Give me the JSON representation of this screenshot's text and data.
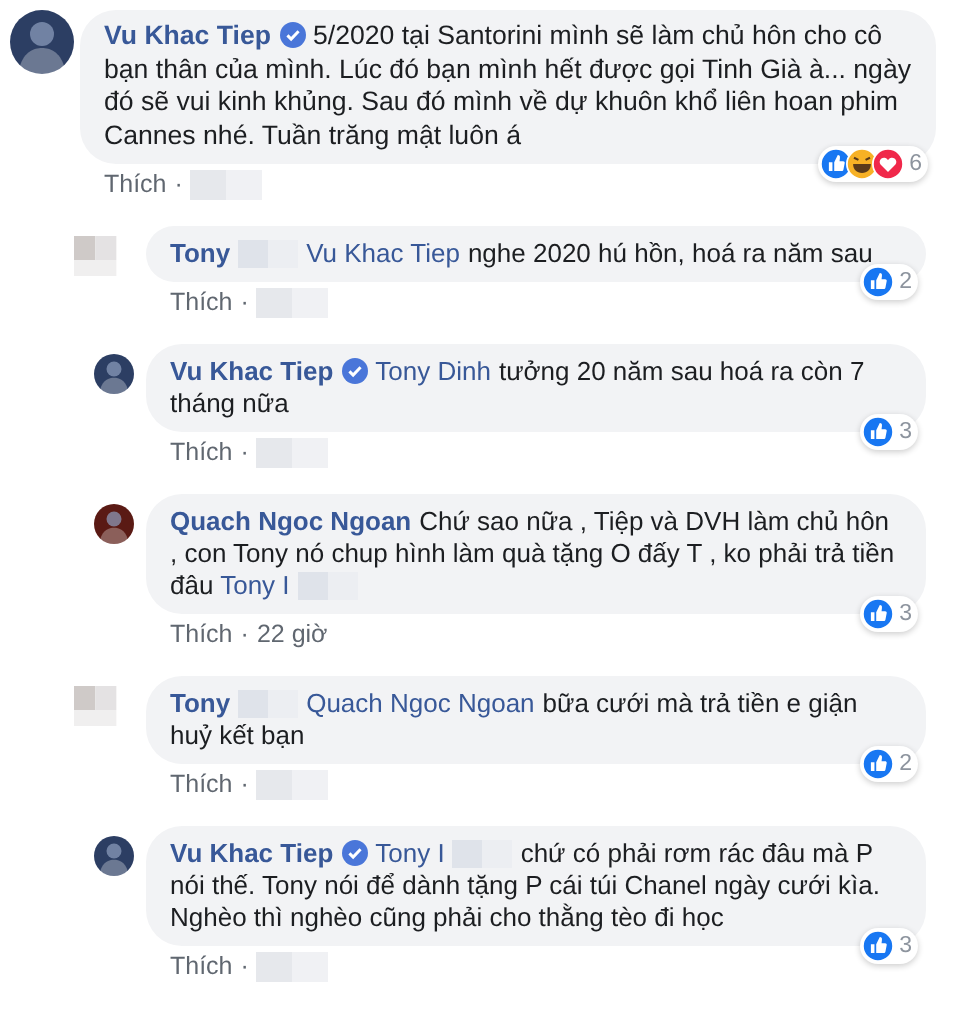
{
  "comments": [
    {
      "avatar": {
        "kind": "photo",
        "color": "#2c3e63"
      },
      "parts": [
        {
          "kind": "author",
          "text": "Vu Khac Tiep"
        },
        {
          "kind": "verified"
        },
        {
          "kind": "text",
          "text": "5/2020 tại Santorini mình sẽ làm chủ hôn cho cô bạn thân của mình. Lúc đó bạn mình hết được gọi Tinh Già à... ngày đó sẽ vui kinh khủng. Sau đó mình về dự khuôn khổ liên hoan phim Cannes nhé. Tuần trăng mật luôn á"
        }
      ],
      "reactions": [
        {
          "kind": "like"
        },
        {
          "kind": "haha"
        },
        {
          "kind": "love"
        }
      ],
      "count": "6",
      "like_label": "Thích",
      "separator": "·",
      "children": [
        {
          "avatar": {
            "kind": "redacted"
          },
          "parts": [
            {
              "kind": "author",
              "text": "Tony"
            },
            {
              "kind": "redacted"
            },
            {
              "kind": "mention",
              "text": "Vu Khac Tiep"
            },
            {
              "kind": "text",
              "text": "nghe 2020 hú hồn, hoá ra năm sau"
            }
          ],
          "reactions": [
            {
              "kind": "like"
            }
          ],
          "count": "2",
          "like_label": "Thích",
          "separator": "·"
        },
        {
          "avatar": {
            "kind": "photo",
            "color": "#2c3e63"
          },
          "parts": [
            {
              "kind": "author",
              "text": "Vu Khac Tiep"
            },
            {
              "kind": "verified"
            },
            {
              "kind": "mention",
              "text": "Tony Dinh"
            },
            {
              "kind": "text",
              "text": "tưởng 20 năm sau hoá ra còn 7 tháng nữa"
            }
          ],
          "reactions": [
            {
              "kind": "like"
            }
          ],
          "count": "3",
          "like_label": "Thích",
          "separator": "·"
        },
        {
          "avatar": {
            "kind": "photo",
            "color": "#5a1a14"
          },
          "parts": [
            {
              "kind": "author",
              "text": "Quach Ngoc Ngoan"
            },
            {
              "kind": "text",
              "text": "Chứ sao nữa , Tiệp và DVH làm chủ hôn , con Tony nó chup hình làm quà tặng O đấy T , ko phải trả tiền đâu"
            },
            {
              "kind": "mention",
              "text": "Tony I"
            },
            {
              "kind": "redacted"
            }
          ],
          "reactions": [
            {
              "kind": "like"
            }
          ],
          "count": "3",
          "like_label": "Thích",
          "separator": "·",
          "time": "22 giờ"
        },
        {
          "avatar": {
            "kind": "redacted"
          },
          "parts": [
            {
              "kind": "author",
              "text": "Tony"
            },
            {
              "kind": "redacted"
            },
            {
              "kind": "mention",
              "text": "Quach Ngoc Ngoan"
            },
            {
              "kind": "text",
              "text": "bữa cưới mà trả tiền e giận huỷ kết bạn"
            }
          ],
          "reactions": [
            {
              "kind": "like"
            }
          ],
          "count": "2",
          "like_label": "Thích",
          "separator": "·"
        },
        {
          "avatar": {
            "kind": "photo",
            "color": "#2c3e63"
          },
          "parts": [
            {
              "kind": "author",
              "text": "Vu Khac Tiep"
            },
            {
              "kind": "verified"
            },
            {
              "kind": "mention",
              "text": "Tony I"
            },
            {
              "kind": "redacted"
            },
            {
              "kind": "text",
              "text": "chứ có phải rơm rác đâu mà P nói thế. Tony nói để dành tặng P cái túi Chanel ngày cưới kìa. Nghèo thì nghèo cũng phải cho thằng tèo đi học"
            }
          ],
          "reactions": [
            {
              "kind": "like"
            }
          ],
          "count": "3",
          "like_label": "Thích",
          "separator": "·"
        }
      ]
    }
  ]
}
